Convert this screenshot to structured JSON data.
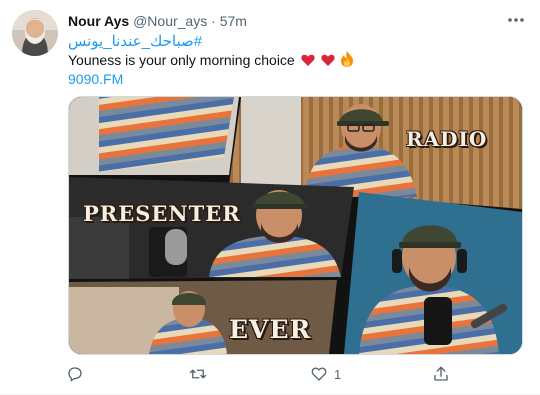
{
  "tweet": {
    "author_name": "Nour Ays",
    "handle": "@Nour_ays",
    "separator": "·",
    "time": "57m",
    "hashtag": "#صباحك_عندنا_يونس",
    "text": "Youness is your only morning choice",
    "link": "9090.FM",
    "emojis": [
      "red-heart",
      "red-heart",
      "fire"
    ]
  },
  "media": {
    "labels": {
      "radio": "RADIO",
      "presenter": "PRESENTER",
      "ever": "EVER"
    }
  },
  "actions": {
    "reply_count": "",
    "retweet_count": "",
    "like_count": "1",
    "share_count": ""
  },
  "colors": {
    "link": "#1d9bf0",
    "secondary_text": "#536471",
    "heart": "#d9263b"
  }
}
